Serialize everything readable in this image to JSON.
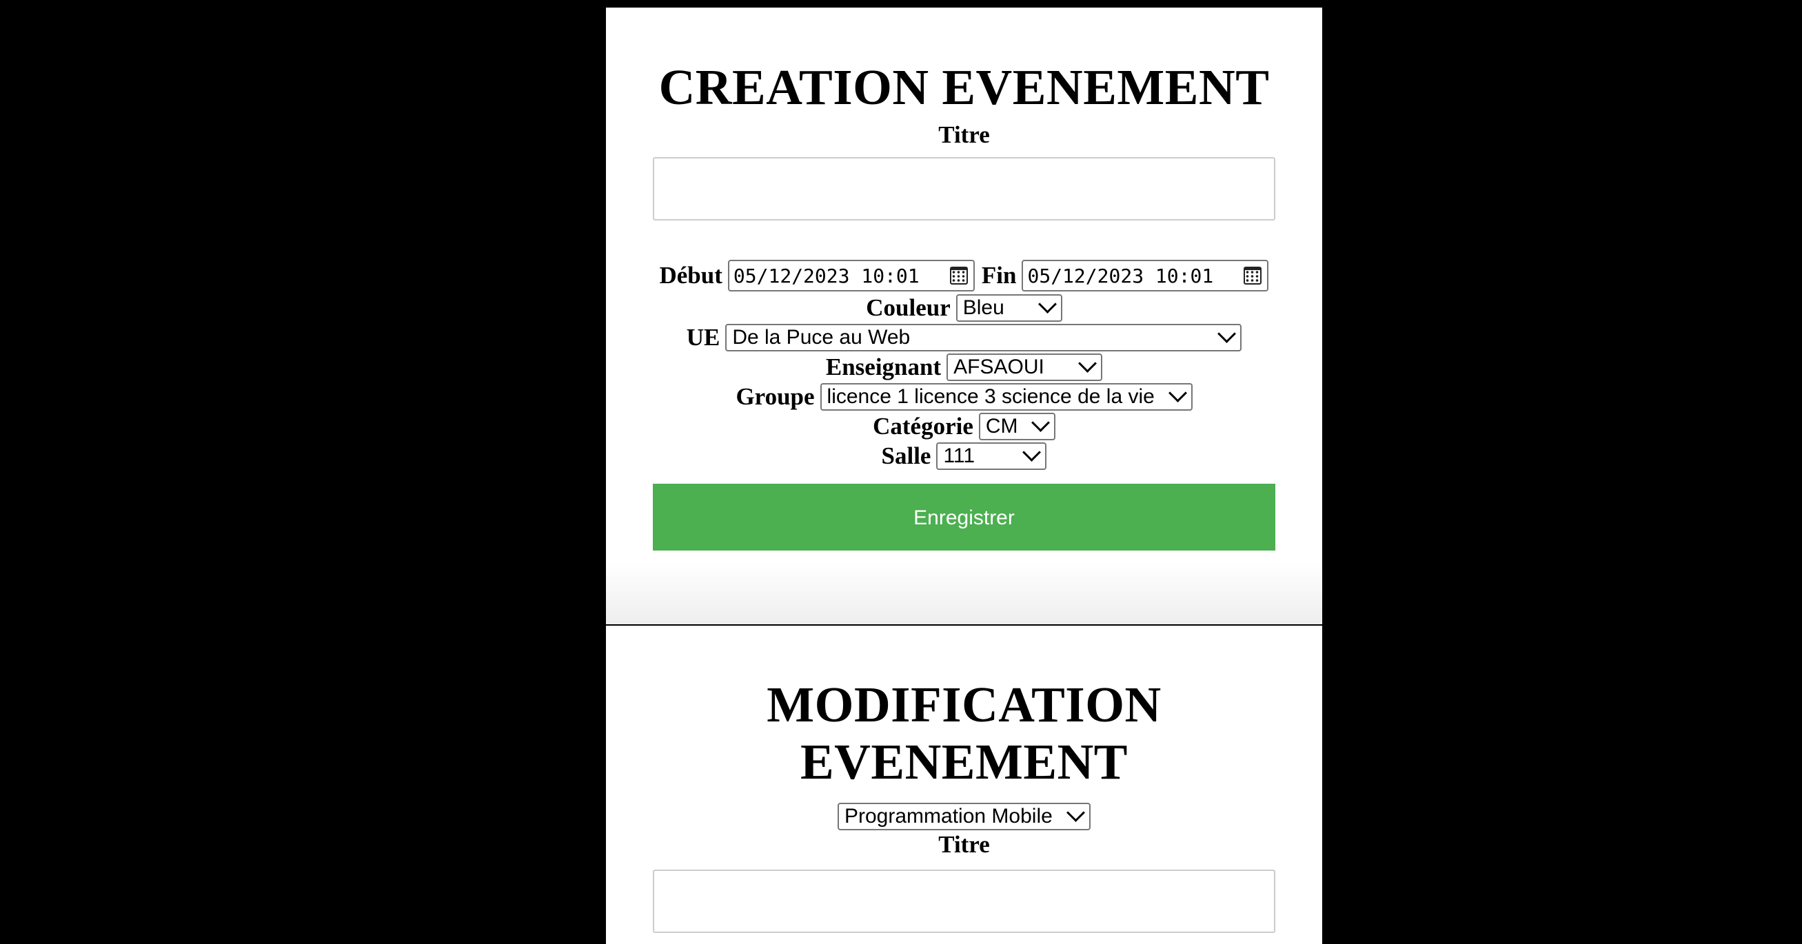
{
  "creation": {
    "heading": "CREATION EVENEMENT",
    "title_label": "Titre",
    "title_value": "",
    "start_label": "Début",
    "start_value": "05/12/2023 10:01",
    "end_label": "Fin",
    "end_value": "05/12/2023 10:01",
    "color_label": "Couleur",
    "color_value": "Bleu",
    "ue_label": "UE",
    "ue_value": "De la Puce au Web",
    "teacher_label": "Enseignant",
    "teacher_value": "AFSAOUI",
    "group_label": "Groupe",
    "group_value": "licence 1 licence 3 science de la vie",
    "category_label": "Catégorie",
    "category_value": "CM",
    "room_label": "Salle",
    "room_value": "111",
    "save_label": "Enregistrer"
  },
  "modification": {
    "heading_line1": "MODIFICATION",
    "heading_line2": "EVENEMENT",
    "event_select_value": "Programmation Mobile",
    "title_label": "Titre",
    "title_value": ""
  },
  "colors": {
    "background": "#000000",
    "panel": "#ffffff",
    "button": "#4caf50",
    "button_text": "#ffffff"
  },
  "icons": {
    "calendar": "calendar-icon",
    "dropdown": "chevron-down-icon"
  }
}
